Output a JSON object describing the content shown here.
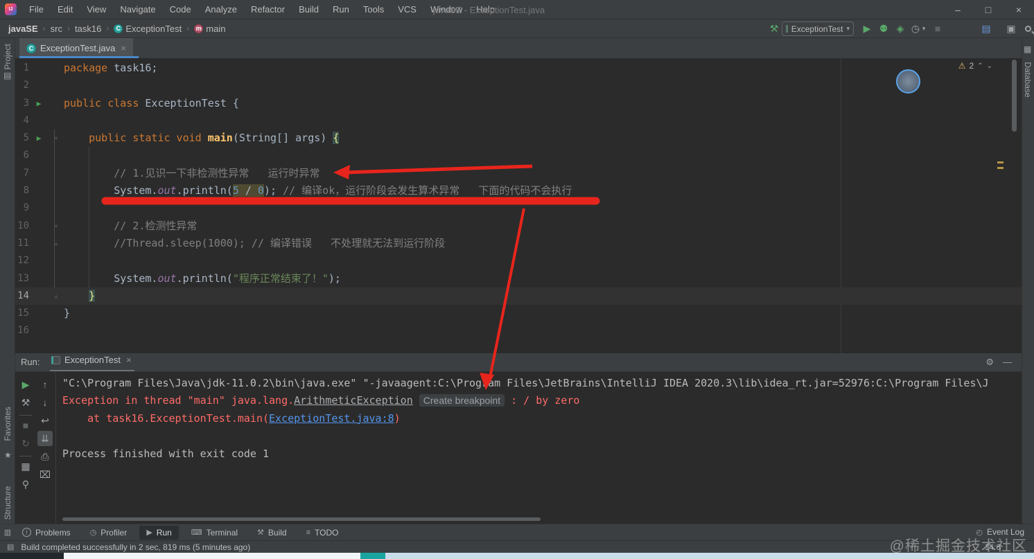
{
  "titlebar": {
    "logo": "IJ",
    "menus": [
      "File",
      "Edit",
      "View",
      "Navigate",
      "Code",
      "Analyze",
      "Refactor",
      "Build",
      "Run",
      "Tools",
      "VCS",
      "Window",
      "Help"
    ],
    "title": "javaSE - ExceptionTest.java",
    "minimize": "–",
    "restore": "□",
    "close": "×"
  },
  "navbar": {
    "breadcrumbs": [
      {
        "label": "javaSE"
      },
      {
        "label": "src"
      },
      {
        "label": "task16"
      },
      {
        "label": "ExceptionTest",
        "icon": "class"
      },
      {
        "label": "main",
        "icon": "method"
      }
    ],
    "separator": "›",
    "build_icon": "⚒",
    "run_config": "ExceptionTest",
    "dropdown": "▾",
    "run_icon": "▶",
    "debug_icon": "⚉",
    "coverage_icon": "◈",
    "profiler_icon": "◷",
    "stop_icon": "■",
    "toolwindows_icon": "▤",
    "recent_icon": "▣"
  },
  "tabbar": {
    "active_tab": "ExceptionTest.java",
    "close": "×",
    "tab_icon_letter": "C"
  },
  "editor": {
    "warning_icon": "⚠",
    "warning_count": "2",
    "chevron_up": "⌃",
    "chevron_down": "⌄",
    "lines": [
      {
        "n": "1",
        "seg": [
          {
            "t": "package ",
            "c": "kw"
          },
          {
            "t": "task16;",
            "c": "pl"
          }
        ]
      },
      {
        "n": "2",
        "seg": []
      },
      {
        "n": "3",
        "run": true,
        "seg": [
          {
            "t": "public class ",
            "c": "kw"
          },
          {
            "t": "ExceptionTest {",
            "c": "pl"
          }
        ]
      },
      {
        "n": "4",
        "seg": []
      },
      {
        "n": "5",
        "run": true,
        "fold": "down",
        "seg": [
          {
            "t": "    ",
            "c": "pl"
          },
          {
            "t": "public static void ",
            "c": "kw"
          },
          {
            "t": "main",
            "c": "meth"
          },
          {
            "t": "(String[] args) ",
            "c": "pl"
          },
          {
            "t": "{",
            "c": "brc"
          }
        ]
      },
      {
        "n": "6",
        "seg": []
      },
      {
        "n": "7",
        "seg": [
          {
            "t": "        ",
            "c": "pl"
          },
          {
            "t": "// 1.见识一下非检测性异常   运行时异常",
            "c": "cmt"
          }
        ]
      },
      {
        "n": "8",
        "seg": [
          {
            "t": "        System.",
            "c": "pl"
          },
          {
            "t": "out",
            "c": "fld"
          },
          {
            "t": ".println(",
            "c": "pl"
          },
          {
            "t": "5",
            "c": "num hl"
          },
          {
            "t": " / ",
            "c": "pl hl"
          },
          {
            "t": "0",
            "c": "num hl"
          },
          {
            "t": "); ",
            "c": "pl"
          },
          {
            "t": "// 编译ok，运行阶段会发生算术异常   下面的代码不会执行",
            "c": "cmt"
          }
        ]
      },
      {
        "n": "9",
        "seg": []
      },
      {
        "n": "10",
        "fold": "down",
        "seg": [
          {
            "t": "        ",
            "c": "pl"
          },
          {
            "t": "// 2.检测性异常",
            "c": "cmt"
          }
        ]
      },
      {
        "n": "11",
        "fold": "up",
        "seg": [
          {
            "t": "        ",
            "c": "pl"
          },
          {
            "t": "//Thread.sleep(1000); // 编译错误   不处理就无法到运行阶段",
            "c": "cmt"
          }
        ]
      },
      {
        "n": "12",
        "seg": []
      },
      {
        "n": "13",
        "seg": [
          {
            "t": "        System.",
            "c": "pl"
          },
          {
            "t": "out",
            "c": "fld"
          },
          {
            "t": ".println(",
            "c": "pl"
          },
          {
            "t": "\"程序正常结束了！\"",
            "c": "str"
          },
          {
            "t": ");",
            "c": "pl"
          }
        ]
      },
      {
        "n": "14",
        "caret": true,
        "fold": "up",
        "seg": [
          {
            "t": "    ",
            "c": "pl"
          },
          {
            "t": "}",
            "c": "brc"
          }
        ]
      },
      {
        "n": "15",
        "seg": [
          {
            "t": "}",
            "c": "pl"
          }
        ]
      },
      {
        "n": "16",
        "seg": []
      }
    ]
  },
  "console": {
    "label": "Run:",
    "tab": "ExceptionTest",
    "close": "×",
    "gear_icon": "⚙",
    "hide_icon": "—",
    "toolbar_main": [
      {
        "g": "▶",
        "name": "rerun-button",
        "cls": "green"
      },
      {
        "g": "⚒",
        "name": "build-wrench-icon"
      },
      {
        "g": "■",
        "name": "stop-button",
        "cls": "dim"
      },
      {
        "g": "↻",
        "name": "rerun-failed-icon",
        "cls": "dim"
      },
      {
        "g": "▦",
        "name": "layout-settings-icon"
      },
      {
        "g": "⚲",
        "name": "pin-tab-icon"
      }
    ],
    "toolbar_console": [
      {
        "g": "↑",
        "name": "prev-stack-trace-icon"
      },
      {
        "g": "↓",
        "name": "next-stack-trace-icon"
      },
      {
        "g": "↩",
        "name": "soft-wrap-icon"
      },
      {
        "g": "⇊",
        "name": "scroll-to-end-icon",
        "sel": true
      },
      {
        "g": "⎙",
        "name": "print-icon"
      },
      {
        "g": "⌧",
        "name": "clear-console-icon"
      }
    ],
    "lines": [
      [
        {
          "t": "\"C:\\Program Files\\Java\\jdk-11.0.2\\bin\\java.exe\" \"-javaagent:C:\\Program Files\\JetBrains\\IntelliJ IDEA 2020.3\\lib\\idea_rt.jar=52976:C:\\Program Files\\J",
          "c": "out"
        }
      ],
      [
        {
          "t": "Exception in thread \"main\" java.lang.",
          "c": "err"
        },
        {
          "t": "ArithmeticException",
          "c": "errlink"
        },
        {
          "t": " ",
          "c": "err"
        },
        {
          "t": "Create breakpoint",
          "c": "hint"
        },
        {
          "t": " : / by zero",
          "c": "err"
        }
      ],
      [
        {
          "t": "    at task16.ExceptionTest.main(",
          "c": "err"
        },
        {
          "t": "ExceptionTest.java:8",
          "c": "link"
        },
        {
          "t": ")",
          "c": "err"
        }
      ],
      [],
      [
        {
          "t": "Process finished with exit code 1",
          "c": "out"
        }
      ]
    ]
  },
  "bottombar": {
    "corner_icon": "▥",
    "items": [
      {
        "label": "Problems",
        "icon": "!",
        "circle": true
      },
      {
        "label": "Profiler",
        "icon": "◷"
      },
      {
        "label": "Run",
        "icon": "▶",
        "active": true
      },
      {
        "label": "Terminal",
        "icon": "⌨"
      },
      {
        "label": "Build",
        "icon": "⚒"
      },
      {
        "label": "TODO",
        "icon": "≡"
      }
    ],
    "event_log": "Event Log",
    "event_icon": "◴"
  },
  "statusbar": {
    "message_icon": "▤",
    "message": "Build completed successfully in 2 sec, 819 ms (5 minutes ago)",
    "position": "14:6",
    "watermark": "@稀土掘金技术社区"
  },
  "stripes": {
    "left_top": "Project",
    "left_mid": "Favorites",
    "left_bottom": "Structure",
    "right": "Database",
    "star": "★",
    "folder_icon": "▤",
    "db_icon": "▦"
  }
}
